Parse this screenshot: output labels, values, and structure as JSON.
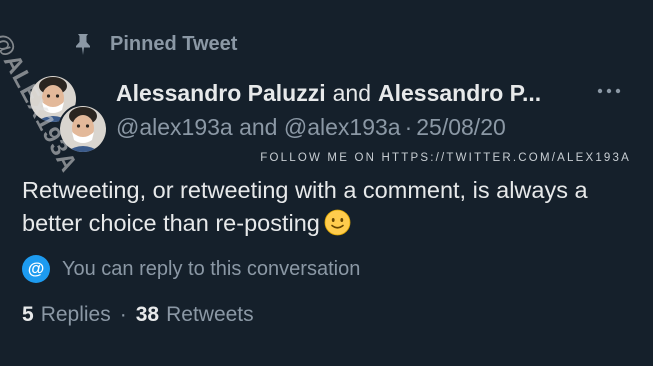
{
  "watermark": "@ALEX193A",
  "pinned": {
    "label": "Pinned Tweet",
    "icon": "pin-icon"
  },
  "tweet": {
    "author1": "Alessandro Paluzzi",
    "connector": "and",
    "author2": "Alessandro P...",
    "handles": "@alex193a and @alex193a",
    "date_sep": "·",
    "date": "25/08/20",
    "follow_line": "FOLLOW ME ON HTTPS://TWITTER.COM/ALEX193A",
    "text": "Retweeting, or retweeting with a comment, is always a better choice than re-posting",
    "emoji": "slightly-smiling-face-icon"
  },
  "reply": {
    "icon_char": "@",
    "label": "You can reply to this conversation"
  },
  "stats": {
    "replies_count": "5",
    "replies_label": "Replies",
    "separator": "·",
    "retweets_count": "38",
    "retweets_label": "Retweets"
  },
  "colors": {
    "background": "#15202b",
    "primary_text": "#e7e9ea",
    "secondary_text": "#8b98a5",
    "accent": "#1d9bf0"
  }
}
